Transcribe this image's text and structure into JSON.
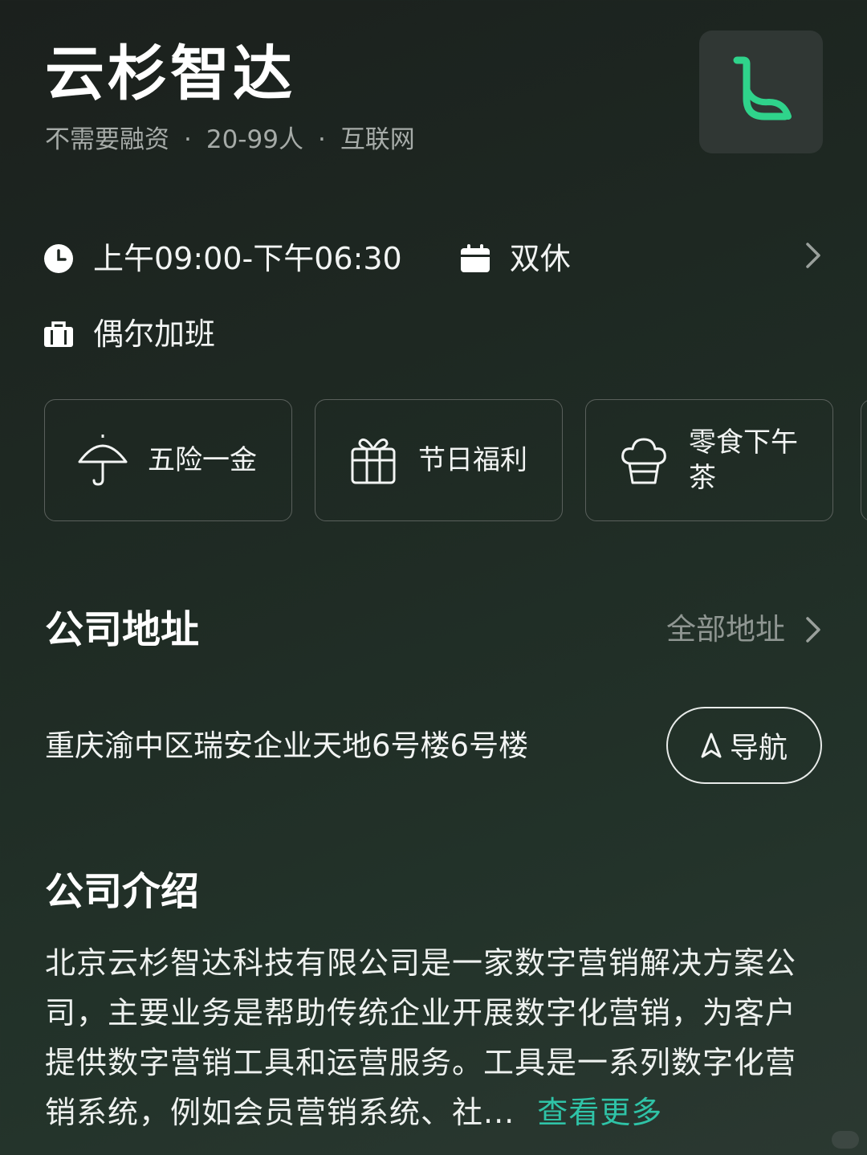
{
  "company": {
    "name": "云杉智达",
    "funding": "不需要融资",
    "size": "20-99人",
    "industry": "互联网",
    "separator": "·",
    "logo_icon": "leaf-l-logo",
    "logo_color": "#2fd38b"
  },
  "schedule": {
    "hours": "上午09:00-下午06:30",
    "hours_icon": "clock-icon",
    "rest": "双休",
    "rest_icon": "calendar-icon",
    "overtime": "偶尔加班",
    "overtime_icon": "briefcase-icon"
  },
  "benefits": [
    {
      "label": "五险一金",
      "icon": "umbrella-icon"
    },
    {
      "label": "节日福利",
      "icon": "gift-icon"
    },
    {
      "label": "零食下午茶",
      "icon": "cupcake-icon"
    }
  ],
  "address_section": {
    "title": "公司地址",
    "all_link": "全部地址",
    "address": "重庆渝中区瑞安企业天地6号楼6号楼",
    "nav_button": "导航"
  },
  "intro_section": {
    "title": "公司介绍",
    "text": "北京云杉智达科技有限公司是一家数字营销解决方案公司，主要业务是帮助传统企业开展数字化营销，为客户提供数字营销工具和运营服务。工具是一系列数字化营销系统，例如会员营销系统、社...",
    "more_link": "查看更多",
    "accent_color": "#2fc3a7"
  }
}
